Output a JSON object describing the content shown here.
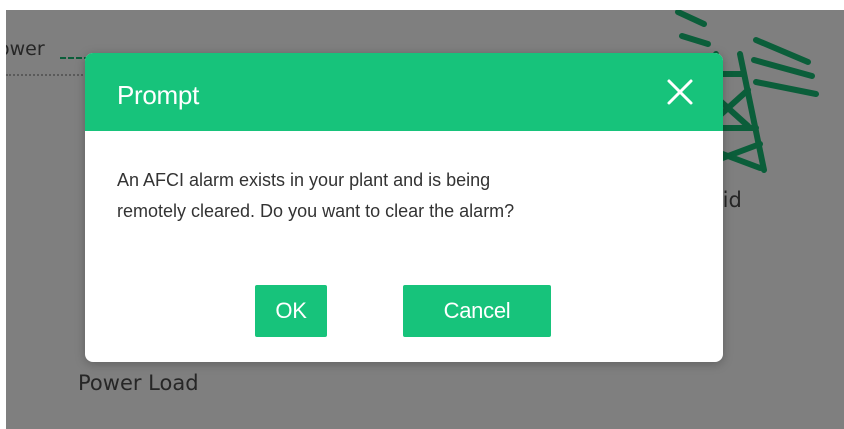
{
  "background": {
    "power_label": "ower",
    "grid_label": "rid",
    "load_label": "Power Load"
  },
  "dialog": {
    "title": "Prompt",
    "close_icon": "close-icon",
    "message_line1": "An AFCI alarm exists in your plant and is being",
    "message_line2": "remotely cleared. Do you want to clear the alarm?",
    "ok_label": "OK",
    "cancel_label": "Cancel"
  },
  "colors": {
    "accent": "#17c37b",
    "overlay": "#7f7f7f",
    "tower": "#0b5e3a"
  }
}
